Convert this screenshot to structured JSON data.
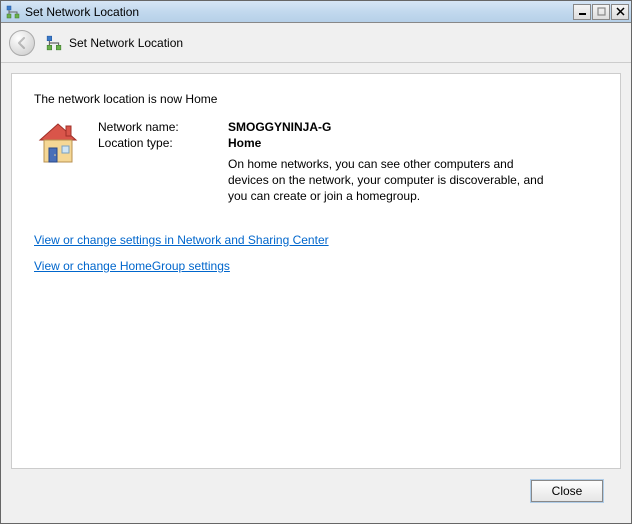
{
  "window": {
    "title": "Set Network Location"
  },
  "header": {
    "title": "Set Network Location"
  },
  "content": {
    "heading": "The network location is now Home",
    "network_name_label": "Network name:",
    "network_name_value": "SMOGGYNINJA-G",
    "location_type_label": "Location type:",
    "location_type_value": "Home",
    "location_desc": "On home networks, you can see other computers and devices on the network, your computer is discoverable, and you can create or join a homegroup."
  },
  "links": {
    "network_sharing": "View or change settings in Network and Sharing Center",
    "homegroup": "View or change HomeGroup settings"
  },
  "footer": {
    "close_label": "Close"
  }
}
